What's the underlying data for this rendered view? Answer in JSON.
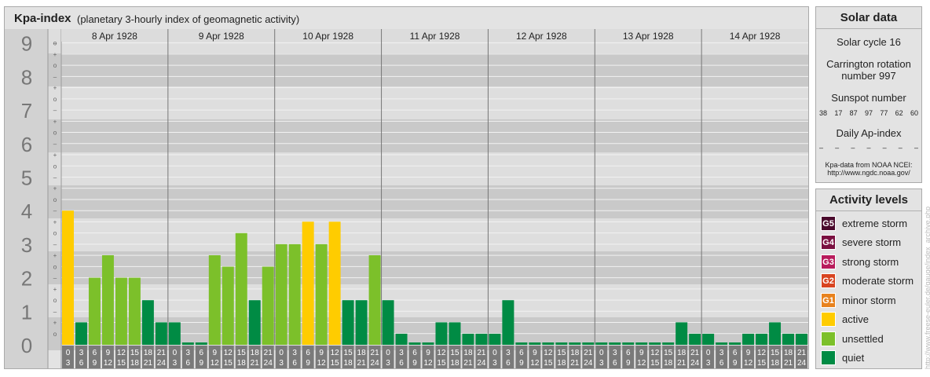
{
  "header": {
    "title": "Kpa-index",
    "subtitle": "(planetary 3-hourly index of geomagnetic activity)"
  },
  "chart_data": {
    "type": "bar",
    "title": "Kpa-index",
    "ylim": [
      0,
      9
    ],
    "y_ticks": [
      "0",
      "1",
      "2",
      "3",
      "4",
      "5",
      "6",
      "7",
      "8",
      "9"
    ],
    "minor_marks": [
      "o",
      "+",
      "–"
    ],
    "days": [
      "8 Apr 1928",
      "9 Apr 1928",
      "10 Apr 1928",
      "11 Apr 1928",
      "12 Apr 1928",
      "13 Apr 1928",
      "14 Apr 1928"
    ],
    "slot_starts": [
      "0",
      "3",
      "6",
      "9",
      "12",
      "15",
      "18",
      "21"
    ],
    "slot_ends": [
      "3",
      "6",
      "9",
      "12",
      "15",
      "18",
      "21",
      "24"
    ],
    "values": [
      4.0,
      0.67,
      2.0,
      2.67,
      2.0,
      2.0,
      1.33,
      0.67,
      0.67,
      0.0,
      0.0,
      2.67,
      2.33,
      3.33,
      1.33,
      2.33,
      3.0,
      3.0,
      3.67,
      3.0,
      3.67,
      1.33,
      1.33,
      2.67,
      1.33,
      0.33,
      0.0,
      0.0,
      0.67,
      0.67,
      0.33,
      0.33,
      0.33,
      1.33,
      0.0,
      0.0,
      0.0,
      0.0,
      0.0,
      0.0,
      0.0,
      0.0,
      0.0,
      0.0,
      0.0,
      0.0,
      0.67,
      0.33,
      0.33,
      0.0,
      0.0,
      0.33,
      0.33,
      0.67,
      0.33,
      0.33
    ],
    "colors": {
      "active": "#ffcc00",
      "unsettled": "#7cc02a",
      "quiet": "#008b44"
    }
  },
  "solar": {
    "title": "Solar data",
    "cycle": "Solar cycle 16",
    "carrington_line1": "Carrington rotation",
    "carrington_line2": "number 997",
    "sunspot_title": "Sunspot number",
    "sunspots": [
      "38",
      "17",
      "87",
      "97",
      "77",
      "62",
      "60"
    ],
    "ap_title": "Daily Ap-index",
    "ap_values": [
      "–",
      "–",
      "–",
      "–",
      "–",
      "–",
      "–"
    ],
    "source_line1": "Kpa-data from NOAA NCEI:",
    "source_line2": "http://www.ngdc.noaa.gov/"
  },
  "levels": {
    "title": "Activity levels",
    "items": [
      {
        "code": "G5",
        "label": "extreme storm",
        "color": "#4a0a2c"
      },
      {
        "code": "G4",
        "label": "severe storm",
        "color": "#7a1040"
      },
      {
        "code": "G3",
        "label": "strong storm",
        "color": "#b81c5c"
      },
      {
        "code": "G2",
        "label": "moderate storm",
        "color": "#d84420"
      },
      {
        "code": "G1",
        "label": "minor storm",
        "color": "#e8821e"
      },
      {
        "code": "",
        "label": "active",
        "color": "#ffcc00"
      },
      {
        "code": "",
        "label": "unsettled",
        "color": "#7cc02a"
      },
      {
        "code": "",
        "label": "quiet",
        "color": "#008b44"
      }
    ]
  },
  "credit": "http://www.freese-euler.de/gauge/index_archive.php"
}
